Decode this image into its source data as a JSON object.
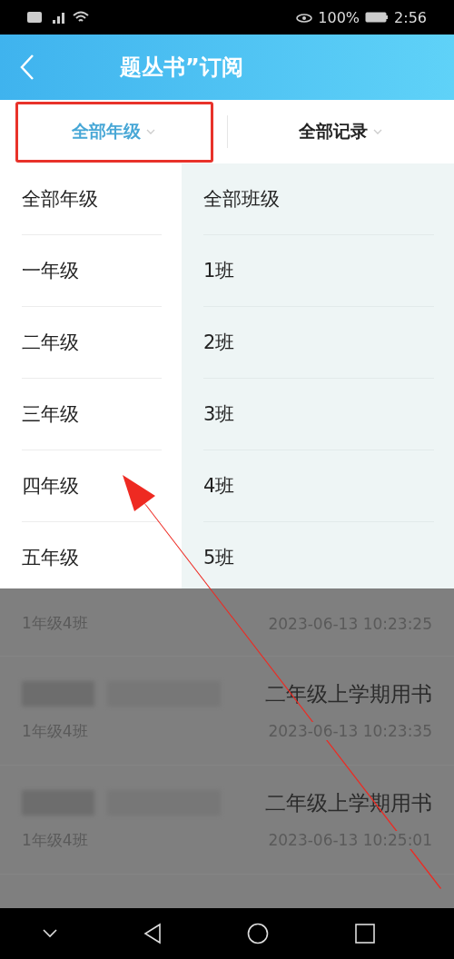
{
  "status_bar": {
    "battery_percent": "100%",
    "time": "2:56"
  },
  "header": {
    "title": "题丛书”订阅"
  },
  "filters": [
    {
      "label": "全部年级",
      "selected": true
    },
    {
      "label": "全部记录",
      "selected": false
    }
  ],
  "dropdown": {
    "grades": [
      "全部年级",
      "一年级",
      "二年级",
      "三年级",
      "四年级",
      "五年级"
    ],
    "classes": [
      "全部班级",
      "1班",
      "2班",
      "3班",
      "4班",
      "5班"
    ]
  },
  "records": [
    {
      "class": "1年级4班",
      "time": "2023-06-13 10:23:25"
    },
    {
      "title": "二年级上学期用书",
      "class": "1年级4班",
      "time": "2023-06-13 10:23:35"
    },
    {
      "title": "二年级上学期用书",
      "class": "1年级4班",
      "time": "2023-06-13 10:25:01"
    }
  ]
}
